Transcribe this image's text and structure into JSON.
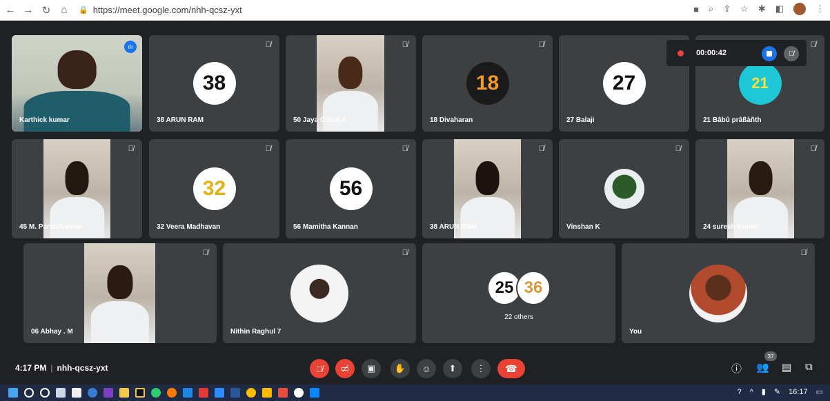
{
  "browser": {
    "url": "https://meet.google.com/nhh-qcsz-yxt"
  },
  "recording": {
    "time": "00:00:42"
  },
  "participants": [
    {
      "name": "Karthick kumar"
    },
    {
      "name": "38 ARUN RAM",
      "avatar_text": "38"
    },
    {
      "name": "50 Jaya Gokul.A"
    },
    {
      "name": "18 Divaharan",
      "avatar_text": "18"
    },
    {
      "name": "27 Balaji",
      "avatar_text": "27"
    },
    {
      "name": "21 Bâbû prâßàñth",
      "avatar_text": "21"
    },
    {
      "name": "45 M. Paranthaman"
    },
    {
      "name": "32 Veera Madhavan",
      "avatar_text": "32"
    },
    {
      "name": "56 Mamitha Kannan",
      "avatar_text": "56"
    },
    {
      "name": "38 ARUN RAM"
    },
    {
      "name": "Vinshan K"
    },
    {
      "name": "24 suresh Kumar"
    },
    {
      "name": "06 Abhay . M"
    },
    {
      "name": "Nithin Raghul 7"
    },
    {
      "name": "You"
    }
  ],
  "others": {
    "label": "22 others",
    "avatars": [
      "25",
      "36"
    ]
  },
  "meeting": {
    "time": "4:17 PM",
    "code": "nhh-qcsz-yxt",
    "participant_count": "37"
  },
  "taskbar": {
    "clock": "16:17"
  },
  "colors": {
    "stage": "#202124",
    "tile": "#3c4043",
    "accent": "#1a73e8",
    "danger": "#ea4335",
    "active_outline": "#8ab4f8"
  }
}
